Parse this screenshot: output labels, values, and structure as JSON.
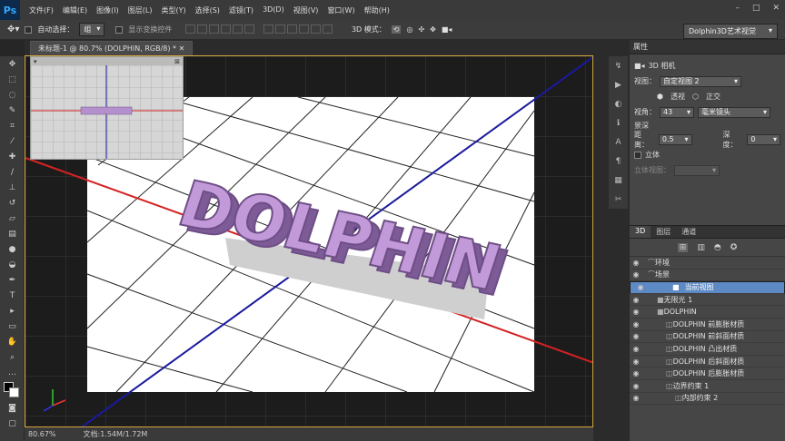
{
  "app": {
    "logo": "Ps"
  },
  "menu": [
    "文件(F)",
    "编辑(E)",
    "图像(I)",
    "图层(L)",
    "类型(Y)",
    "选择(S)",
    "滤镜(T)",
    "3D(D)",
    "视图(V)",
    "窗口(W)",
    "帮助(H)"
  ],
  "window_controls": [
    "–",
    "□",
    "✕"
  ],
  "options": {
    "auto_select_label": "自动选择：",
    "auto_select_value": "组",
    "show_transform_label": "显示变换控件",
    "mode_label": "3D 模式：",
    "workspace": "Dolphin3D艺术视觉"
  },
  "document": {
    "tab_title": "未标题-1 @ 80.7% (DOLPHIN, RGB/8) *",
    "zoom": "80.67%",
    "doc_size": "文档:1.54M/1.72M"
  },
  "scene_text": "DOLPHIN",
  "properties": {
    "header": "属性",
    "camera_label": "3D 相机",
    "view_label": "视图：",
    "view_value": "自定视图 2",
    "perspective": "透视",
    "ortho": "正交",
    "fov_label": "视角：",
    "fov_value": "43",
    "fov_unit": "毫米镜头",
    "dof_title": "景深",
    "distance_label": "距离：",
    "distance_value": "0.5",
    "depth_label": "深度：",
    "depth_value": "0",
    "stereo_label": "立体",
    "stereo_view_label": "立体视图："
  },
  "tabs_3d": [
    "3D",
    "图层",
    "通道"
  ],
  "scene_tree": [
    {
      "label": "环境",
      "indent": 0,
      "selected": false
    },
    {
      "label": "场景",
      "indent": 0,
      "selected": false
    },
    {
      "label": "当前视图",
      "indent": 1,
      "selected": true
    },
    {
      "label": "无限光 1",
      "indent": 1,
      "selected": false
    },
    {
      "label": "DOLPHIN",
      "indent": 1,
      "selected": false
    },
    {
      "label": "DOLPHIN 前膨胀材质",
      "indent": 2,
      "selected": false
    },
    {
      "label": "DOLPHIN 前斜面材质",
      "indent": 2,
      "selected": false
    },
    {
      "label": "DOLPHIN 凸出材质",
      "indent": 2,
      "selected": false
    },
    {
      "label": "DOLPHIN 后斜面材质",
      "indent": 2,
      "selected": false
    },
    {
      "label": "DOLPHIN 后膨胀材质",
      "indent": 2,
      "selected": false
    },
    {
      "label": "边界约束 1",
      "indent": 2,
      "selected": false
    },
    {
      "label": "内部约束 2",
      "indent": 3,
      "selected": false
    }
  ],
  "colors": {
    "accent": "#d6a63c",
    "selection": "#5d89c4",
    "text_purple": "#c39ad9"
  }
}
